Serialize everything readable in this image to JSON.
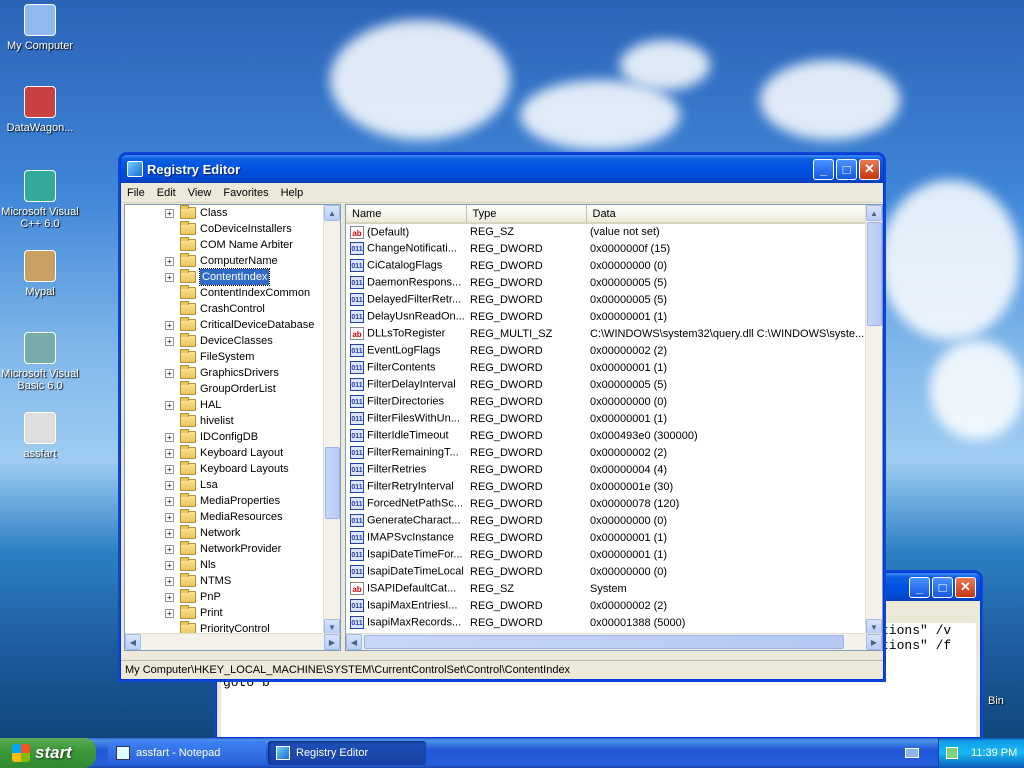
{
  "desktop": {
    "icons": [
      {
        "label": "My Computer",
        "icon": "my-computer-icon"
      },
      {
        "label": "DataWagon...",
        "icon": "datawagon-shortcut-icon"
      },
      {
        "label": "Microsoft Visual C++ 6.0",
        "icon": "visual-cpp-shortcut-icon"
      },
      {
        "label": "Mypal",
        "icon": "mypal-browser-icon"
      },
      {
        "label": "Microsoft Visual Basic 6.0",
        "icon": "visual-basic-shortcut-icon"
      },
      {
        "label": "assfart",
        "icon": "batch-file-icon"
      }
    ],
    "recycle_partial": "Bin"
  },
  "notepad_bg": {
    "lines": [
      "tions\" /v",
      "tions\" /f",
      "goto b"
    ]
  },
  "regedit": {
    "title": "Registry Editor",
    "menu": [
      "File",
      "Edit",
      "View",
      "Favorites",
      "Help"
    ],
    "tree": [
      {
        "label": "Class",
        "expandable": true
      },
      {
        "label": "CoDeviceInstallers",
        "expandable": false
      },
      {
        "label": "COM Name Arbiter",
        "expandable": false
      },
      {
        "label": "ComputerName",
        "expandable": true
      },
      {
        "label": "ContentIndex",
        "expandable": true,
        "selected": true
      },
      {
        "label": "ContentIndexCommon",
        "expandable": false
      },
      {
        "label": "CrashControl",
        "expandable": false
      },
      {
        "label": "CriticalDeviceDatabase",
        "expandable": true
      },
      {
        "label": "DeviceClasses",
        "expandable": true
      },
      {
        "label": "FileSystem",
        "expandable": false
      },
      {
        "label": "GraphicsDrivers",
        "expandable": true
      },
      {
        "label": "GroupOrderList",
        "expandable": false
      },
      {
        "label": "HAL",
        "expandable": true
      },
      {
        "label": "hivelist",
        "expandable": false
      },
      {
        "label": "IDConfigDB",
        "expandable": true
      },
      {
        "label": "Keyboard Layout",
        "expandable": true
      },
      {
        "label": "Keyboard Layouts",
        "expandable": true
      },
      {
        "label": "Lsa",
        "expandable": true
      },
      {
        "label": "MediaProperties",
        "expandable": true
      },
      {
        "label": "MediaResources",
        "expandable": true
      },
      {
        "label": "Network",
        "expandable": true
      },
      {
        "label": "NetworkProvider",
        "expandable": true
      },
      {
        "label": "Nls",
        "expandable": true
      },
      {
        "label": "NTMS",
        "expandable": true
      },
      {
        "label": "PnP",
        "expandable": true
      },
      {
        "label": "Print",
        "expandable": true
      },
      {
        "label": "PriorityControl",
        "expandable": false
      }
    ],
    "columns": [
      "Name",
      "Type",
      "Data"
    ],
    "values": [
      {
        "name": "(Default)",
        "type": "REG_SZ",
        "data": "(value not set)",
        "kind": "sz"
      },
      {
        "name": "ChangeNotificati...",
        "type": "REG_DWORD",
        "data": "0x0000000f (15)",
        "kind": "bin"
      },
      {
        "name": "CiCatalogFlags",
        "type": "REG_DWORD",
        "data": "0x00000000 (0)",
        "kind": "bin"
      },
      {
        "name": "DaemonRespons...",
        "type": "REG_DWORD",
        "data": "0x00000005 (5)",
        "kind": "bin"
      },
      {
        "name": "DelayedFilterRetr...",
        "type": "REG_DWORD",
        "data": "0x00000005 (5)",
        "kind": "bin"
      },
      {
        "name": "DelayUsnReadOn...",
        "type": "REG_DWORD",
        "data": "0x00000001 (1)",
        "kind": "bin"
      },
      {
        "name": "DLLsToRegister",
        "type": "REG_MULTI_SZ",
        "data": "C:\\WINDOWS\\system32\\query.dll C:\\WINDOWS\\syste...",
        "kind": "sz"
      },
      {
        "name": "EventLogFlags",
        "type": "REG_DWORD",
        "data": "0x00000002 (2)",
        "kind": "bin"
      },
      {
        "name": "FilterContents",
        "type": "REG_DWORD",
        "data": "0x00000001 (1)",
        "kind": "bin"
      },
      {
        "name": "FilterDelayInterval",
        "type": "REG_DWORD",
        "data": "0x00000005 (5)",
        "kind": "bin"
      },
      {
        "name": "FilterDirectories",
        "type": "REG_DWORD",
        "data": "0x00000000 (0)",
        "kind": "bin"
      },
      {
        "name": "FilterFilesWithUn...",
        "type": "REG_DWORD",
        "data": "0x00000001 (1)",
        "kind": "bin"
      },
      {
        "name": "FilterIdleTimeout",
        "type": "REG_DWORD",
        "data": "0x000493e0 (300000)",
        "kind": "bin"
      },
      {
        "name": "FilterRemainingT...",
        "type": "REG_DWORD",
        "data": "0x00000002 (2)",
        "kind": "bin"
      },
      {
        "name": "FilterRetries",
        "type": "REG_DWORD",
        "data": "0x00000004 (4)",
        "kind": "bin"
      },
      {
        "name": "FilterRetryInterval",
        "type": "REG_DWORD",
        "data": "0x0000001e (30)",
        "kind": "bin"
      },
      {
        "name": "ForcedNetPathSc...",
        "type": "REG_DWORD",
        "data": "0x00000078 (120)",
        "kind": "bin"
      },
      {
        "name": "GenerateCharact...",
        "type": "REG_DWORD",
        "data": "0x00000000 (0)",
        "kind": "bin"
      },
      {
        "name": "IMAPSvcInstance",
        "type": "REG_DWORD",
        "data": "0x00000001 (1)",
        "kind": "bin"
      },
      {
        "name": "IsapiDateTimeFor...",
        "type": "REG_DWORD",
        "data": "0x00000001 (1)",
        "kind": "bin"
      },
      {
        "name": "IsapiDateTimeLocal",
        "type": "REG_DWORD",
        "data": "0x00000000 (0)",
        "kind": "bin"
      },
      {
        "name": "ISAPIDefaultCat...",
        "type": "REG_SZ",
        "data": "System",
        "kind": "sz"
      },
      {
        "name": "IsapiMaxEntriesI...",
        "type": "REG_DWORD",
        "data": "0x00000002 (2)",
        "kind": "bin"
      },
      {
        "name": "IsapiMaxRecords...",
        "type": "REG_DWORD",
        "data": "0x00001388 (5000)",
        "kind": "bin"
      }
    ],
    "status": "My Computer\\HKEY_LOCAL_MACHINE\\SYSTEM\\CurrentControlSet\\Control\\ContentIndex"
  },
  "taskbar": {
    "start_label": "start",
    "tasks": [
      {
        "label": "assfart - Notepad",
        "icon": "notepad-icon",
        "active": false
      },
      {
        "label": "Registry Editor",
        "icon": "regedit-icon",
        "active": true
      }
    ],
    "clock": "11:39 PM"
  },
  "colors": {
    "selection": "#316ac5",
    "titlebar": "#0053e3",
    "taskbar": "#245edb"
  }
}
